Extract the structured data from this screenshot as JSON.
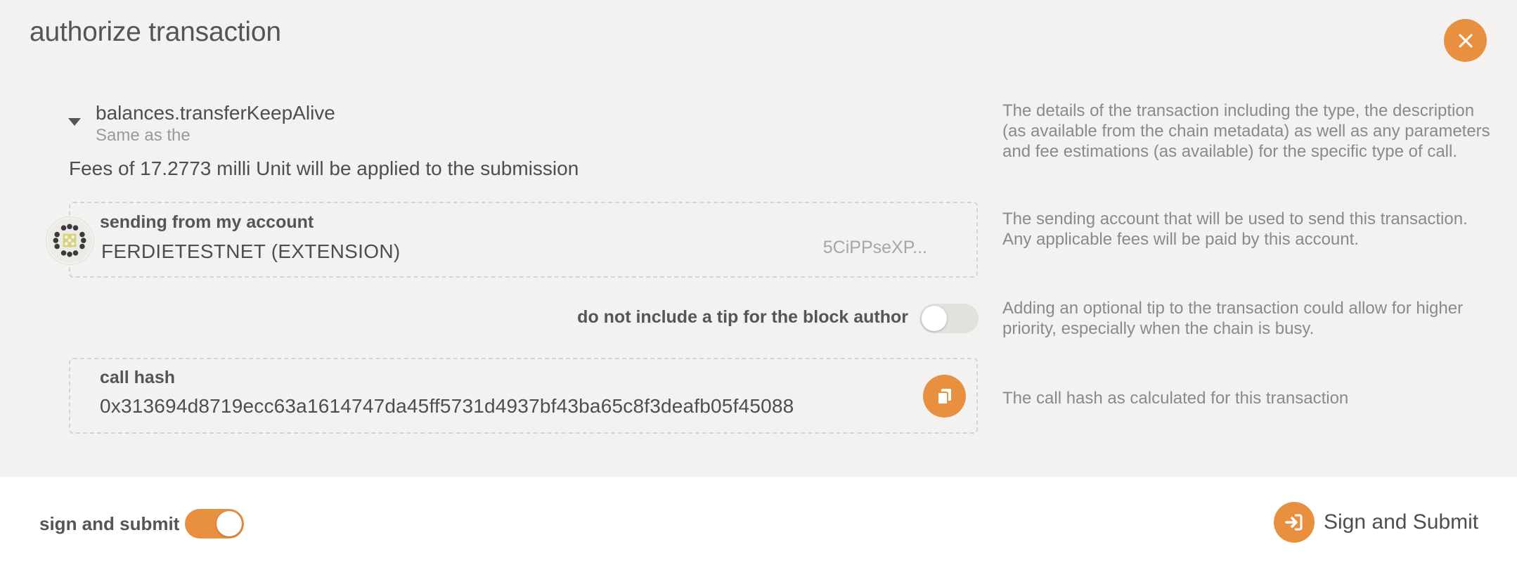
{
  "modal": {
    "title": "authorize transaction"
  },
  "call": {
    "method": "balances.transferKeepAlive",
    "description": "Same as the",
    "fees": "Fees of 17.2773 milli Unit will be applied to the submission"
  },
  "account": {
    "label": "sending from my account",
    "name": "FERDIETESTNET (EXTENSION)",
    "address": "5CiPPseXP..."
  },
  "tip": {
    "label": "do not include a tip for the block author",
    "enabled": false
  },
  "hash": {
    "label": "call hash",
    "value": "0x313694d8719ecc63a1614747da45ff5731d4937bf43ba65c8f3deafb05f45088"
  },
  "help": {
    "details": "The details of the transaction including the type, the description (as available from the chain metadata) as well as any parameters and fee estimations (as available) for the specific type of call.",
    "account": "The sending account that will be used to send this transaction. Any applicable fees will be paid by this account.",
    "tip": "Adding an optional tip to the transaction could allow for higher priority, especially when the chain is busy.",
    "hash": "The call hash as calculated for this transaction"
  },
  "footer": {
    "sign_label": "sign and submit",
    "sign_enabled": true,
    "submit_label": "Sign and Submit"
  },
  "colors": {
    "accent": "#e8903f",
    "background": "#f3f2f0",
    "footer_bg": "#ffffff"
  },
  "icons": {
    "close": "close-icon",
    "copy": "copy-icon",
    "submit": "sign-in-icon",
    "expand": "chevron-down-icon"
  }
}
